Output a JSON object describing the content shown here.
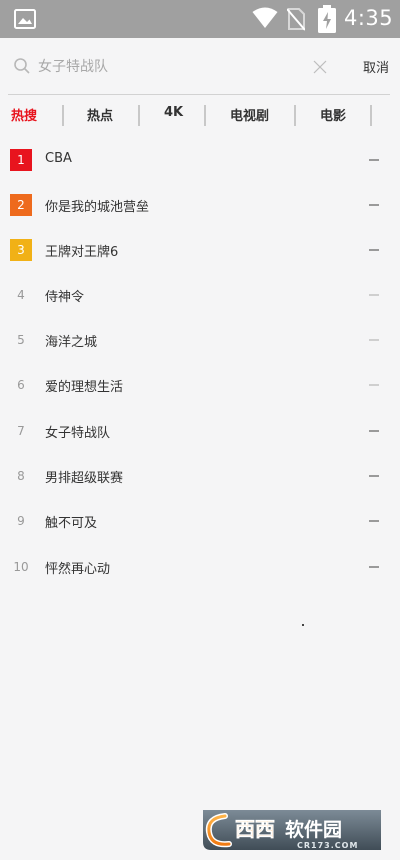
{
  "status_bar": {
    "time": "4:35",
    "icons": [
      "image-icon",
      "wifi-icon",
      "no-sim-icon",
      "battery-charging-icon"
    ]
  },
  "search": {
    "placeholder": "女子特战队",
    "cancel_label": "取消"
  },
  "tabs": [
    {
      "label": "热搜",
      "active": true
    },
    {
      "label": "热点",
      "active": false
    },
    {
      "label": "4K",
      "active": false
    },
    {
      "label": "电视剧",
      "active": false
    },
    {
      "label": "电影",
      "active": false
    }
  ],
  "rankings": [
    {
      "rank": "1",
      "title": "CBA",
      "badge_color": "#e8141e",
      "trend": "flat-dark"
    },
    {
      "rank": "2",
      "title": "你是我的城池营垒",
      "badge_color": "#ee6a1d",
      "trend": "flat-dark"
    },
    {
      "rank": "3",
      "title": "王牌对王牌6",
      "badge_color": "#f1b116",
      "trend": "flat-dark"
    },
    {
      "rank": "4",
      "title": "侍神令",
      "trend": "flat-light"
    },
    {
      "rank": "5",
      "title": "海洋之城",
      "trend": "flat-light"
    },
    {
      "rank": "6",
      "title": "爱的理想生活",
      "trend": "flat-light"
    },
    {
      "rank": "7",
      "title": "女子特战队",
      "trend": "flat-dark"
    },
    {
      "rank": "8",
      "title": "男排超级联赛",
      "trend": "flat-dark"
    },
    {
      "rank": "9",
      "title": "触不可及",
      "trend": "flat-dark"
    },
    {
      "rank": "10",
      "title": "怦然再心动",
      "trend": "flat-dark"
    }
  ],
  "colors": {
    "accent": "#e8141e",
    "trend_dark": "#9a9a9a",
    "trend_light": "#cfcfcf"
  },
  "watermark": {
    "text": "西西软件园",
    "domain": "CR173.COM"
  }
}
